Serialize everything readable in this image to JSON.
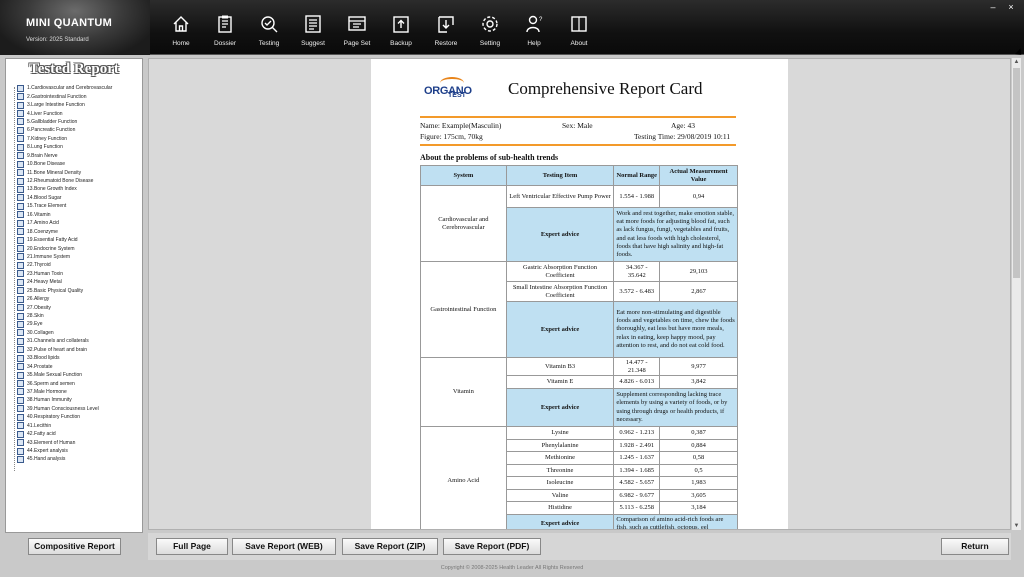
{
  "app": {
    "name": "MINI QUANTUM",
    "version": "Version: 2025 Standard"
  },
  "nav": [
    "Home",
    "Dossier",
    "Testing",
    "Suggest",
    "Page Set",
    "Backup",
    "Restore",
    "Setting",
    "Help",
    "About"
  ],
  "window": {
    "minimize": "–",
    "close": "×"
  },
  "left": {
    "title": "Tested Report",
    "items": [
      "1.Cardiovascular and Cerebrovascular",
      "2.Gastrointestinal Function",
      "3.Large Intestine Function",
      "4.Liver Function",
      "5.Gallbladder Function",
      "6.Pancreatic Function",
      "7.Kidney Function",
      "8.Lung Function",
      "9.Brain Nerve",
      "10.Bone Disease",
      "11.Bone Mineral Density",
      "12.Rheumatoid Bone Disease",
      "13.Bone Growth Index",
      "14.Blood Sugar",
      "15.Trace Element",
      "16.Vitamin",
      "17.Amino Acid",
      "18.Coenzyme",
      "19.Essential Fatty Acid",
      "20.Endocrine System",
      "21.Immune System",
      "22.Thyroid",
      "23.Human Toxin",
      "24.Heavy Metal",
      "25.Basic Physical Quality",
      "26.Allergy",
      "27.Obesity",
      "28.Skin",
      "29.Eye",
      "30.Collagen",
      "31.Channels and collaterals",
      "32.Pulse of heart and brain",
      "33.Blood lipids",
      "34.Prostate",
      "35.Male Sexual Function",
      "36.Sperm and semen",
      "37.Male Hormone",
      "38.Human Immunity",
      "39.Human Consciousness Level",
      "40.Respiratory Function",
      "41.Lecithin",
      "42.Fatty acid",
      "43.Element of Human",
      "44.Expert analysis",
      "45.Hand analysis"
    ]
  },
  "report": {
    "logo_top": "ORGANO",
    "logo_bottom": "TEST",
    "title": "Comprehensive Report Card",
    "name": "Name: Example(Masculin)",
    "sex": "Sex: Male",
    "age": "Age: 43",
    "figure": "Figure: 175cm, 70kg",
    "testing_time": "Testing Time: 29/08/2019 10:11",
    "section": "About the problems of sub-health trends",
    "headers": {
      "system": "System",
      "item": "Testing Item",
      "normal": "Normal Range",
      "actual": "Actual Measurement Value"
    },
    "expert_label": "Expert advice",
    "cardio": {
      "system": "Cardiovascular and Cerebrovascular",
      "item": "Left Ventricular Effective Pump Power",
      "range": "1.554 - 1.988",
      "value": "0,94",
      "advice": "Work and rest together, make emotion stable, eat more foods for adjusting blood fat, such as lack fungus, fungi, vegetables and fruits, and eat less foods with high cholesterol, foods that have high salinity and high-fat foods."
    },
    "gastro": {
      "system": "Gastrointestinal Function",
      "item1": "Gastric Absorption Function Coefficient",
      "range1": "34.367 - 35.642",
      "value1": "29,103",
      "item2": "Small Intestine Absorption Function Coefficient",
      "range2": "3.572 - 6.483",
      "value2": "2,867",
      "advice": "Eat more non-stimulating and digestible foods and vegetables on time, chew the foods thoroughly, eat less but have more meals, relax in eating, keep happy mood, pay attention to rest, and do not eat cold food."
    },
    "vitamin": {
      "system": "Vitamin",
      "item1": "Vitamin B3",
      "range1": "14.477 - 21.348",
      "value1": "9,977",
      "item2": "Vitamin E",
      "range2": "4.826 - 6.013",
      "value2": "3,842",
      "advice": "Supplement corresponding lacking trace elements by using a variety of foods, or by using through drugs or health products, if necessary."
    },
    "amino": {
      "system": "Amino Acid",
      "rows": [
        {
          "item": "Lysine",
          "range": "0.962 - 1.213",
          "value": "0,387"
        },
        {
          "item": "Phenylalanine",
          "range": "1.928 - 2.491",
          "value": "0,884"
        },
        {
          "item": "Methionine",
          "range": "1.245 - 1.637",
          "value": "0,58"
        },
        {
          "item": "Threonine",
          "range": "1.394 - 1.685",
          "value": "0,5"
        },
        {
          "item": "Isoleucine",
          "range": "4.582 - 5.657",
          "value": "1,983"
        },
        {
          "item": "Valine",
          "range": "6.982 - 9.677",
          "value": "3,605"
        },
        {
          "item": "Histidine",
          "range": "5.113 - 6.258",
          "value": "3,184"
        }
      ],
      "advice": "Comparison of amino acid-rich foods are fish, such as cuttlefish, octopus, eel"
    }
  },
  "buttons": {
    "compositive": "Compositive Report",
    "full_page": "Full Page",
    "save_web": "Save Report (WEB)",
    "save_zip": "Save Report (ZIP)",
    "save_pdf": "Save Report (PDF)",
    "return": "Return"
  },
  "copyright": "Copyright © 2008-2025 Health Leader All Rights Reserved"
}
